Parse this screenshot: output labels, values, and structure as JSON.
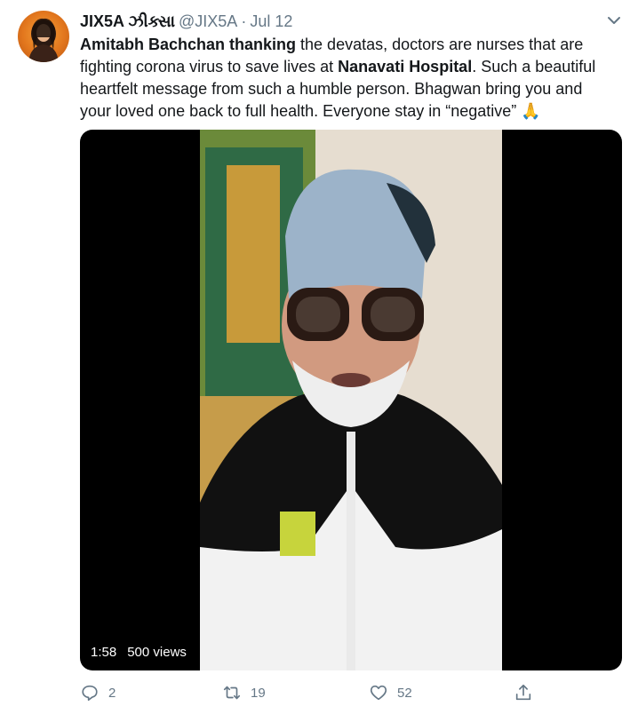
{
  "tweet": {
    "display_name": "JIX5A ઝીક્સા",
    "handle": "@JIX5A",
    "separator": "·",
    "date": "Jul 12",
    "text": {
      "bold1": "Amitabh Bachchan thanking",
      "part1": " the devatas, doctors are nurses that are fighting corona virus to save lives at ",
      "bold2": "Nanavati Hospital",
      "part2": ". Such a beautiful heartfelt message from such a humble person. Bhagwan bring you and your loved one back to full health. Everyone stay in  “negative” ",
      "emoji": "🙏"
    },
    "media": {
      "duration": "1:58",
      "views": "500 views"
    },
    "actions": {
      "replies": "2",
      "retweets": "19",
      "likes": "52"
    },
    "icons": {
      "menu": "chevron-down-icon",
      "reply": "reply-icon",
      "retweet": "retweet-icon",
      "like": "heart-icon",
      "share": "share-icon"
    }
  }
}
